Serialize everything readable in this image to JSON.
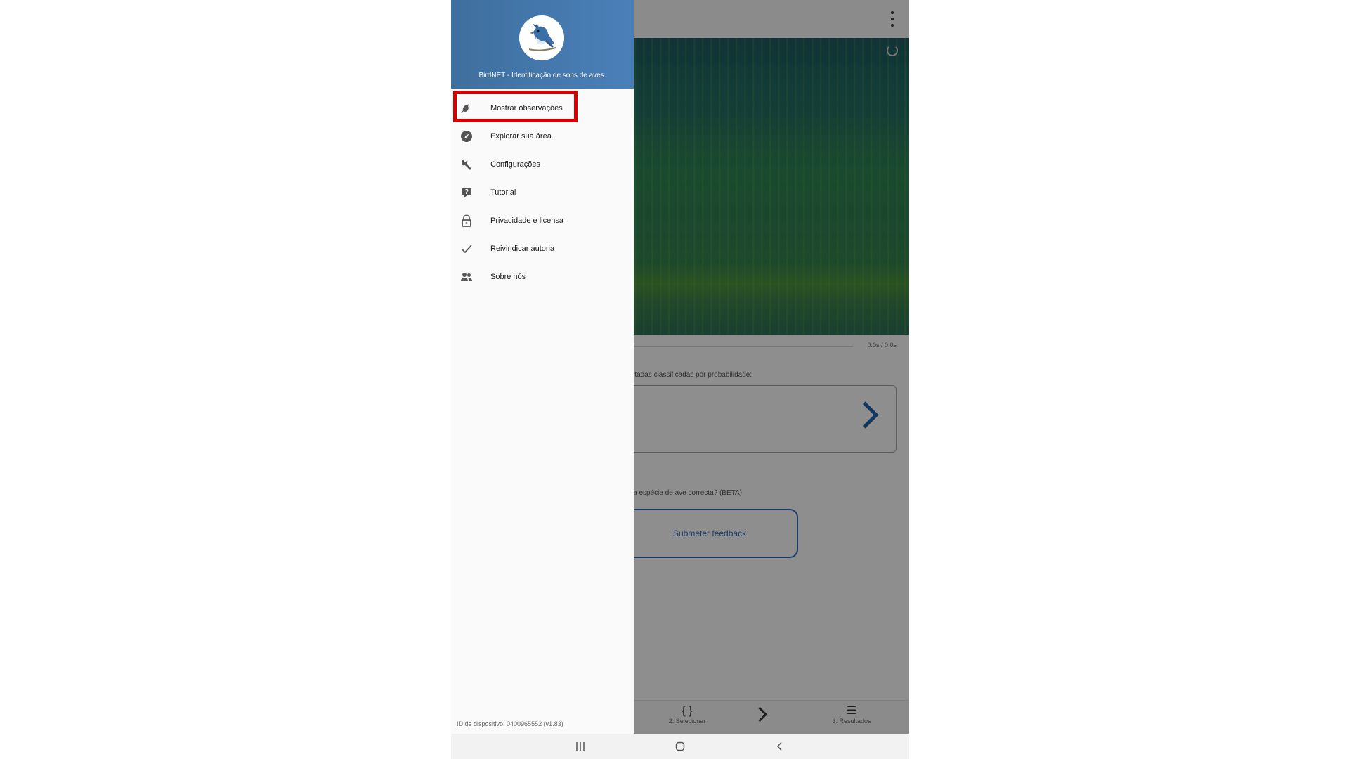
{
  "drawer": {
    "title": "BirdNET - Identificação de sons de aves.",
    "items": [
      {
        "label": "Mostrar observações",
        "icon": "bird-icon"
      },
      {
        "label": "Explorar sua área",
        "icon": "compass-icon"
      },
      {
        "label": "Configurações",
        "icon": "wrench-icon"
      },
      {
        "label": "Tutorial",
        "icon": "help-icon"
      },
      {
        "label": "Privacidade e licensa",
        "icon": "lock-icon"
      },
      {
        "label": "Reivindicar autoria",
        "icon": "check-icon"
      },
      {
        "label": "Sobre nós",
        "icon": "people-icon"
      }
    ],
    "device_id": "ID de dispositivo: 0400965552 (v1.83)"
  },
  "background": {
    "time_label": "0.0s / 0.0s",
    "results_caption": "tectadas classificadas por probabilidade:",
    "feedback_caption": "ta a espécie de ave correcta? (BETA)",
    "feedback_button": "Submeter feedback",
    "bottom_nav": [
      {
        "label": "2. Selecionar",
        "icon": "brackets-icon"
      },
      {
        "label": "",
        "icon": "chevron-right-icon"
      },
      {
        "label": "3. Resultados",
        "icon": "list-icon"
      }
    ]
  },
  "colors": {
    "header_blue": "#4a80b9",
    "highlight_red": "#d40000",
    "accent_blue": "#2f67b0"
  }
}
